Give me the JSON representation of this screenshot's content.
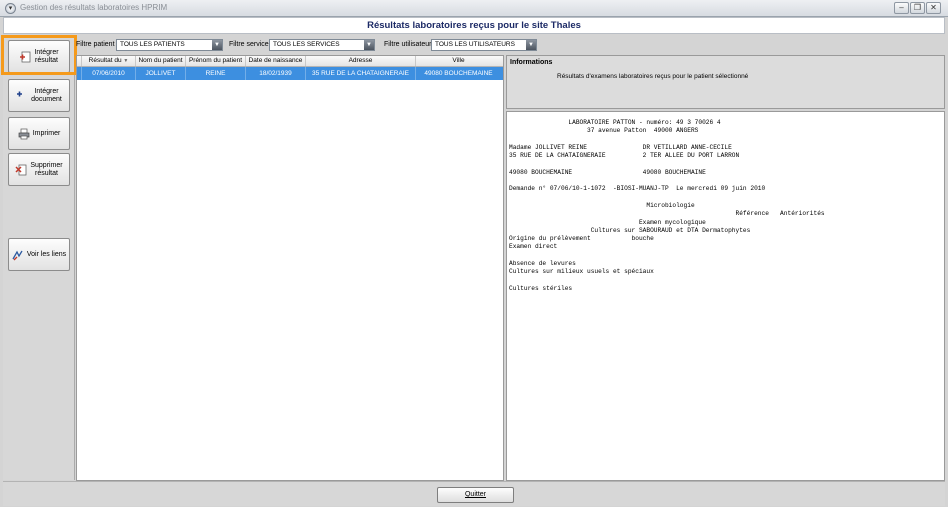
{
  "window": {
    "title": "Gestion des résultats laboratoires HPRIM",
    "menu_glyph": "▾",
    "controls": {
      "minimize": "–",
      "restore": "❐",
      "close": "✕"
    }
  },
  "header": {
    "title": "Résultats laboratoires reçus pour le site Thales"
  },
  "sidebar": {
    "integrer_resultat": [
      "Intégrer",
      "résultat"
    ],
    "integrer_document": [
      "Intégrer",
      "document"
    ],
    "imprimer": "Imprimer",
    "supprimer_resultat": [
      "Supprimer",
      "résultat"
    ],
    "voir_liens": "Voir les liens"
  },
  "filters": {
    "patient_label": "Filtre patient",
    "patient_value": "TOUS LES PATIENTS",
    "service_label": "Filtre service",
    "service_value": "TOUS LES SERVICES",
    "user_label": "Filtre utilisateur",
    "user_value": "TOUS LES UTILISATEURS"
  },
  "table": {
    "columns": [
      "Résultat du",
      "Nom du patient",
      "Prénom du patient",
      "Date de naissance",
      "Adresse",
      "Ville"
    ],
    "sort_glyph": "▼",
    "rows": [
      [
        "07/06/2010",
        "JOLLIVET",
        "REINE",
        "18/02/1939",
        "35 RUE DE LA CHATAIGNERAIE",
        "49080 BOUCHEMAINE"
      ]
    ]
  },
  "info": {
    "heading": "Informations",
    "text": "Résultats d'examens laboratoires reçus pour le patient sélectionné"
  },
  "report": {
    "lines": [
      "                LABORATOIRE PATTON - numéro: 49 3 70026 4",
      "                     37 avenue Patton  49000 ANGERS",
      "",
      "Madame JOLLIVET REINE               DR VETILLARD ANNE-CECILE",
      "35 RUE DE LA CHATAIGNERAIE          2 TER ALLEE DU PORT LARRON",
      "",
      "49080 BOUCHEMAINE                   49080 BOUCHEMAINE",
      "",
      "Demande n° 07/06/10-1-1072  -BIOSI-MUANJ-TP  Le mercredi 09 juin 2010",
      "",
      "                                     Microbiologie",
      "                                                             Référence   Antériorités",
      "                                   Examen mycologique",
      "                      Cultures sur SABOURAUD et DTA Dermatophytes",
      "Origine du prélèvement           bouche",
      "Examen direct",
      "",
      "Absence de levures",
      "Cultures sur milieux usuels et spéciaux",
      "",
      "Cultures stériles"
    ]
  },
  "footer": {
    "quit_label": "Quitter"
  },
  "colors": {
    "selection": "#3d8fe0",
    "highlight": "#f59a1b",
    "header_text": "#1c2a66"
  },
  "icons": [
    "add-result-icon",
    "add-document-icon",
    "printer-icon",
    "delete-result-icon",
    "links-icon"
  ]
}
